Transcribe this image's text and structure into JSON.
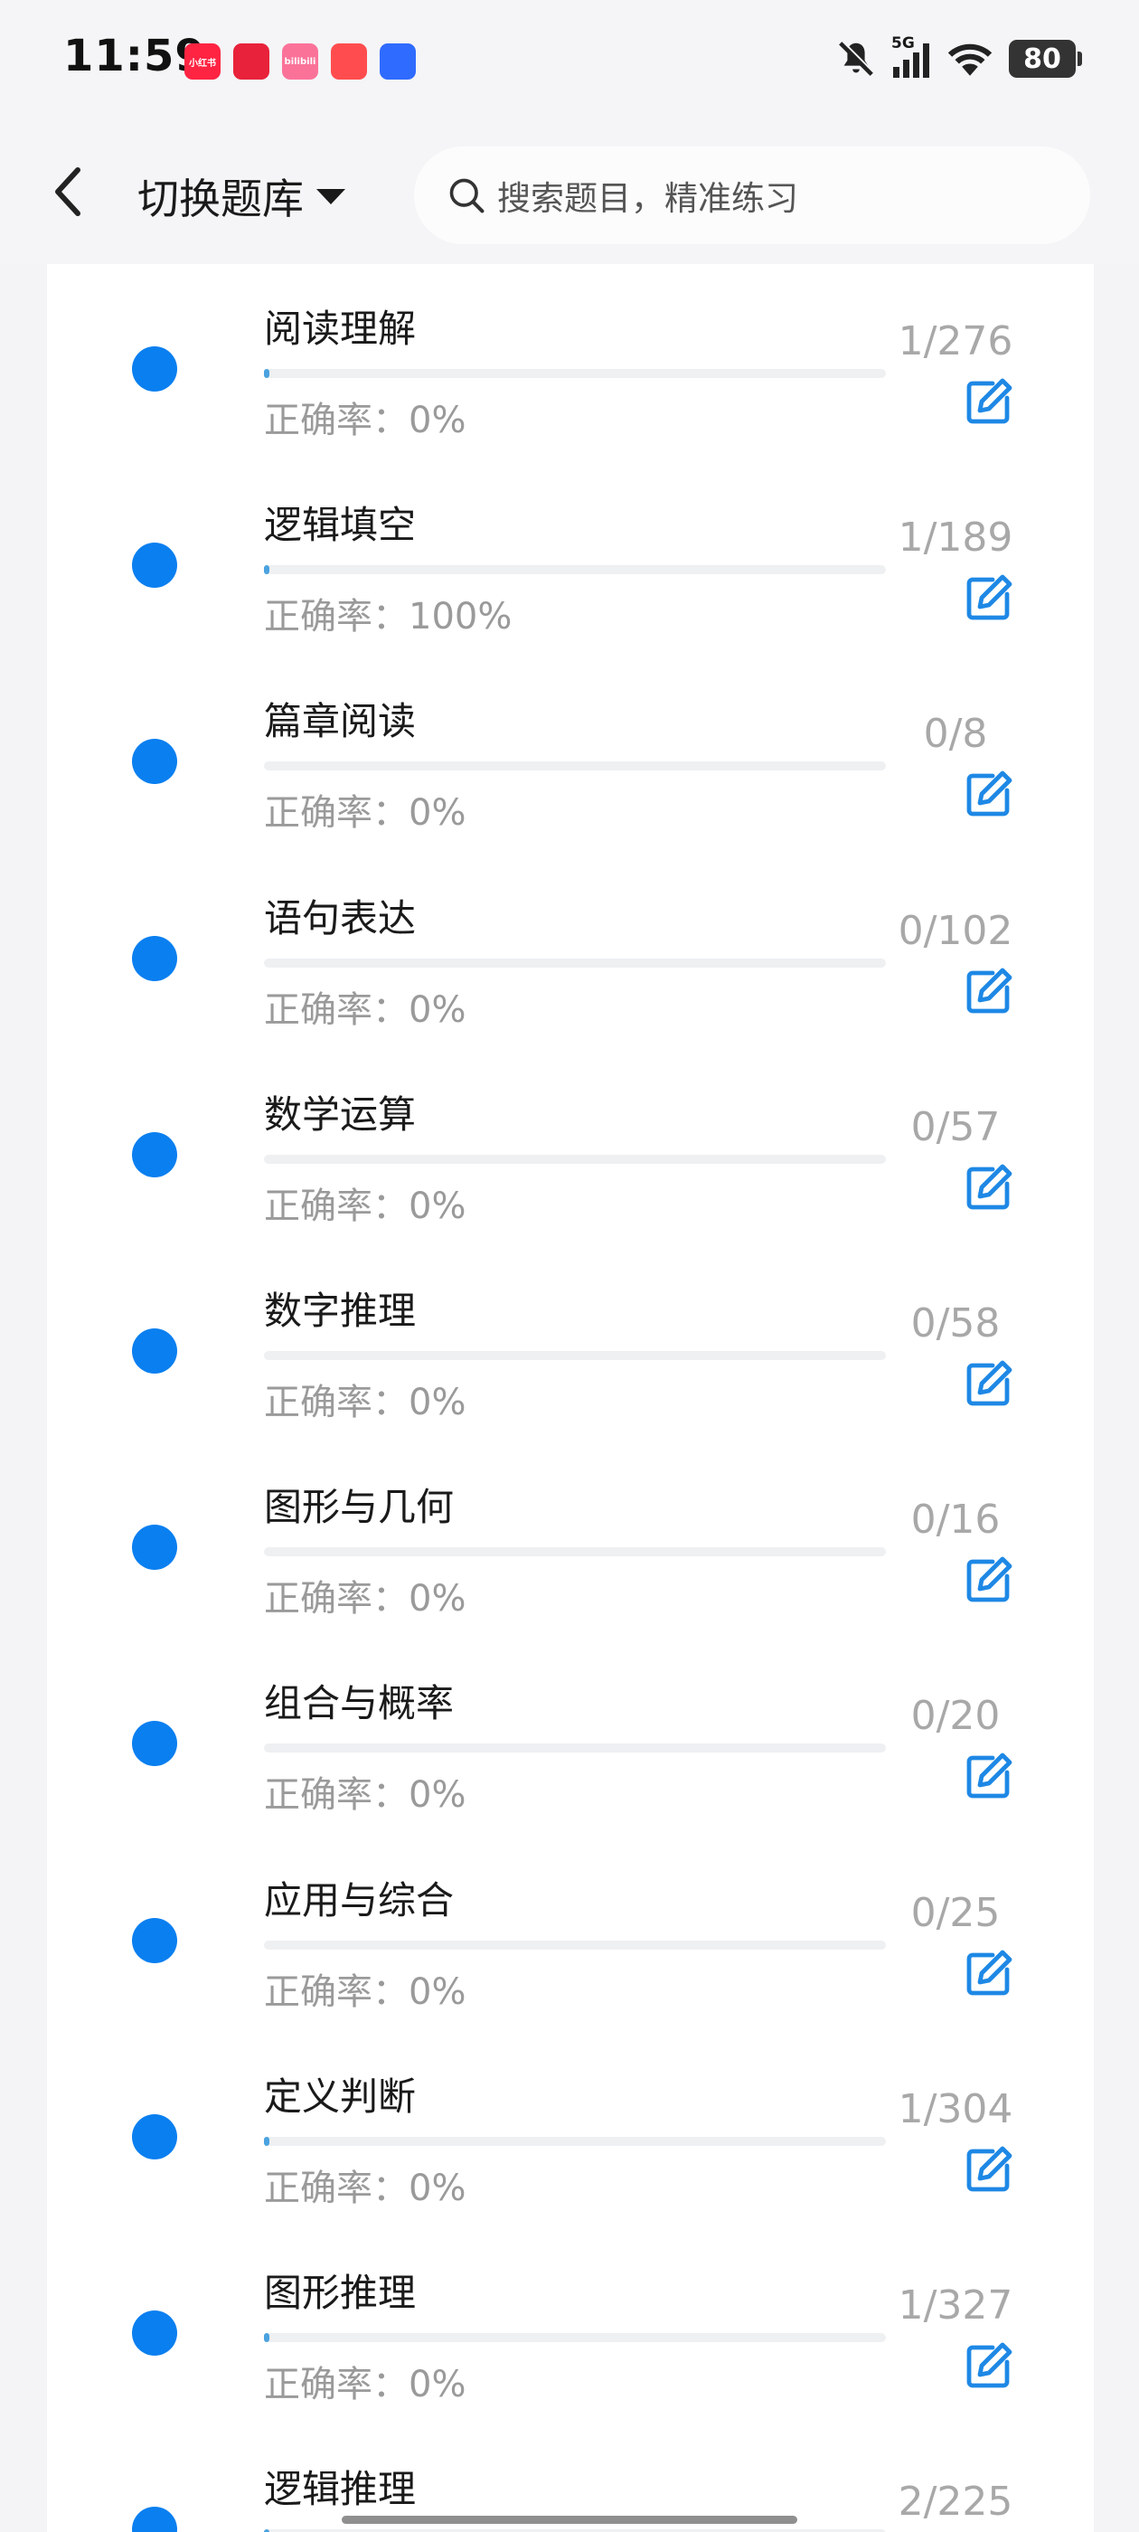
{
  "status_bar": {
    "time": "11:59",
    "apps": [
      {
        "name": "xiaohongshu-app-icon",
        "label": "小红书",
        "color": "#ff2442"
      },
      {
        "name": "heart-app-icon",
        "label": "",
        "color": "#e8223a"
      },
      {
        "name": "bilibili-app-icon",
        "label": "bilibili",
        "color": "#fb7299"
      },
      {
        "name": "sail-app-icon",
        "label": "",
        "color": "#ff4d4f"
      },
      {
        "name": "shield-app-icon",
        "label": "",
        "color": "#2f6bff"
      }
    ],
    "network": "5G",
    "battery": "80"
  },
  "header": {
    "switch_label": "切换题库",
    "search_placeholder": "搜索题目，精准练习"
  },
  "topics": [
    {
      "title": "阅读理解",
      "accuracy": "正确率：0%",
      "count": "1/276",
      "progress": 0.0036
    },
    {
      "title": "逻辑填空",
      "accuracy": "正确率：100%",
      "count": "1/189",
      "progress": 0.0053
    },
    {
      "title": "篇章阅读",
      "accuracy": "正确率：0%",
      "count": "0/8",
      "progress": 0
    },
    {
      "title": "语句表达",
      "accuracy": "正确率：0%",
      "count": "0/102",
      "progress": 0
    },
    {
      "title": "数学运算",
      "accuracy": "正确率：0%",
      "count": "0/57",
      "progress": 0
    },
    {
      "title": "数字推理",
      "accuracy": "正确率：0%",
      "count": "0/58",
      "progress": 0
    },
    {
      "title": "图形与几何",
      "accuracy": "正确率：0%",
      "count": "0/16",
      "progress": 0
    },
    {
      "title": "组合与概率",
      "accuracy": "正确率：0%",
      "count": "0/20",
      "progress": 0
    },
    {
      "title": "应用与综合",
      "accuracy": "正确率：0%",
      "count": "0/25",
      "progress": 0
    },
    {
      "title": "定义判断",
      "accuracy": "正确率：0%",
      "count": "1/304",
      "progress": 0.0033
    },
    {
      "title": "图形推理",
      "accuracy": "正确率：0%",
      "count": "1/327",
      "progress": 0.0031
    },
    {
      "title": "逻辑推理",
      "accuracy": "",
      "count": "2/225",
      "progress": 0.0089
    }
  ],
  "colors": {
    "dot": "#0a7ff0",
    "edit_icon": "#1e88e5",
    "progress_fill": "#4aa3e0"
  }
}
